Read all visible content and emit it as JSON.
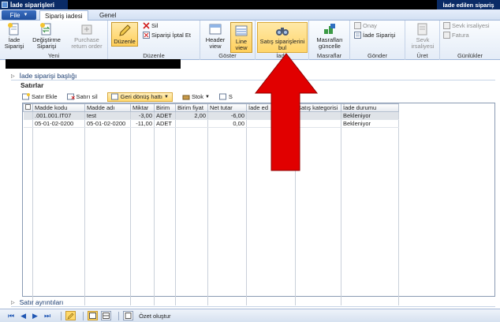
{
  "window": {
    "title": "İade siparişleri",
    "title_right": "İade edilen sipariş"
  },
  "tabs": {
    "file": "File",
    "items": [
      "Sipariş iadesi",
      "Genel"
    ]
  },
  "ribbon": {
    "new": {
      "label": "Yeni",
      "iade_siparisi": "İade Siparişi",
      "degistirme_siparisi": "Değiştirme Siparişi",
      "purchase_return_order": "Purchase return order"
    },
    "edit": {
      "label": "Düzenle",
      "duzenle": "Düzenle",
      "sil": "Sil",
      "siparis_iptal_et": "Siparişi İptal Et"
    },
    "show": {
      "label": "Göster",
      "header_view": "Header view",
      "line_view": "Line view"
    },
    "find": {
      "label": "İade",
      "satis_siparislerini_bul": "Satış siparişlerini bul"
    },
    "expenses": {
      "label": "Masraflar",
      "masraflari_guncelle": "Masrafları güncelle"
    },
    "send": {
      "label": "Gönder",
      "onay": "Onay",
      "iade_siparisi": "İade Siparişi"
    },
    "generate": {
      "label": "Üret",
      "sevk_irsaliyesi": "Sevk irsaliyesi"
    },
    "journals": {
      "label": "Günlükler",
      "sevk_irsaliyesi": "Sevk irsaliyesi",
      "fatura": "Fatura"
    }
  },
  "sections": {
    "header": "İade siparişi başlığı",
    "lines": "Satırlar",
    "details": "Satır ayrıntıları"
  },
  "grid_toolbar": {
    "add_line": "Satır Ekle",
    "delete_line": "Satırı sil",
    "return_line": "Geri dönüş hattı",
    "stock": "Stok",
    "extra": "S"
  },
  "grid": {
    "columns": [
      "Madde kodu",
      "Madde adı",
      "Miktar",
      "Birim",
      "Birim fiyat",
      "Net tutar",
      "İade ed",
      "Satış kategorisi",
      "İade durumu"
    ],
    "rows": [
      {
        "code": ".001.001.IT07",
        "name": "test",
        "qty": "-3,00",
        "unit": "ADET",
        "price": "2,00",
        "net": "-6,00",
        "ret": "",
        "cat": "",
        "status": "Bekleniyor"
      },
      {
        "code": "05-01-02-0200",
        "name": "05-01-02-0200",
        "qty": "-11,00",
        "unit": "ADET",
        "price": "",
        "net": "0,00",
        "ret": "",
        "cat": "",
        "status": "Bekleniyor"
      }
    ]
  },
  "bottombar": {
    "summary": "Özet oluştur"
  },
  "colors": {
    "titlebar": "#0a2b66",
    "arrow": "#e10000",
    "highlight": "#ffd56a"
  }
}
